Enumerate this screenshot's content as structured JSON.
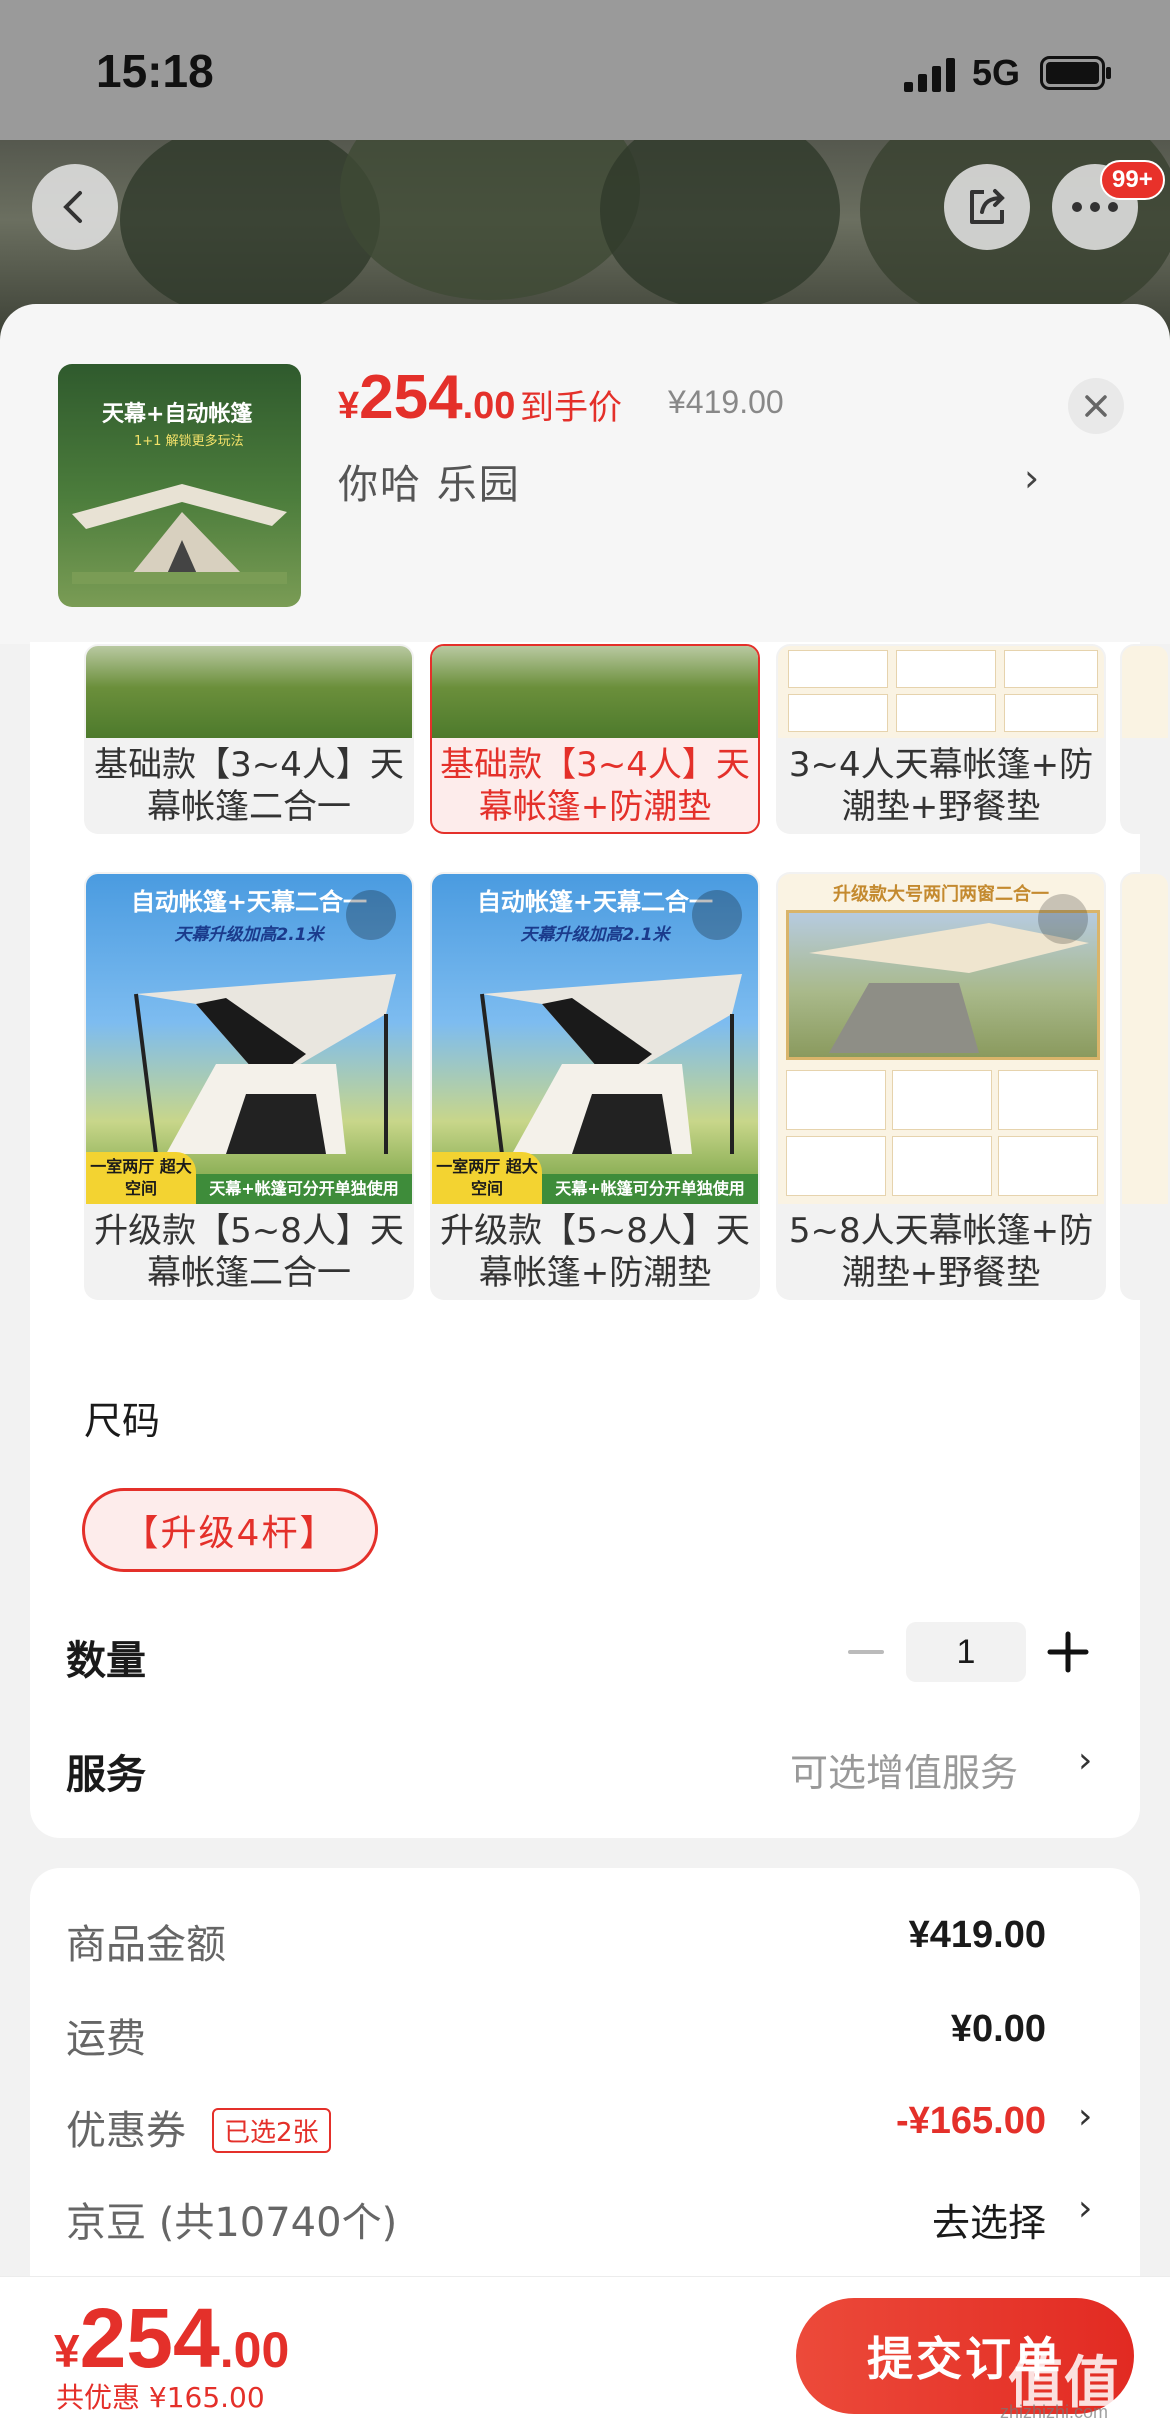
{
  "status_bar": {
    "time": "15:18",
    "network": "5G"
  },
  "header": {
    "back_icon": "chevron-left-icon",
    "share_icon": "share-icon",
    "more_icon": "more-icon",
    "more_badge": "99+"
  },
  "product": {
    "thumb_title": "天幕+自动帐篷",
    "thumb_tag": "1+1 解锁更多玩法",
    "price_currency": "¥",
    "price_int": "254",
    "price_dec": ".00",
    "price_label": "到手价",
    "original_price": "¥419.00",
    "selected_spec": "你哈  乐园"
  },
  "variants": [
    {
      "label": "基础款【3~4人】天幕帐篷二合一",
      "selected": false
    },
    {
      "label": "基础款【3~4人】天幕帐篷+防潮垫",
      "selected": true
    },
    {
      "label": "3~4人天幕帐篷+防潮垫+野餐垫",
      "selected": false
    },
    {
      "label": "升级款【5~8人】天幕帐篷二合一",
      "selected": false,
      "img_title": "自动帐篷+天幕二合一",
      "img_sub": "天幕升级加高2.1米",
      "img_yellow": "一室两厅 超大空间",
      "img_green": "天幕+帐篷可分开单独使用"
    },
    {
      "label": "升级款【5~8人】天幕帐篷+防潮垫",
      "selected": false,
      "img_title": "自动帐篷+天幕二合一",
      "img_sub": "天幕升级加高2.1米",
      "img_yellow": "一室两厅 超大空间",
      "img_green": "天幕+帐篷可分开单独使用"
    },
    {
      "label": "5~8人天幕帐篷+防潮垫+野餐垫",
      "selected": false,
      "img_title": "升级款大号两门两窗二合一"
    }
  ],
  "size": {
    "label": "尺码",
    "option": "【升级4杆】"
  },
  "quantity": {
    "label": "数量",
    "value": "1"
  },
  "service": {
    "label": "服务",
    "value": "可选增值服务"
  },
  "summary": {
    "goods_label": "商品金额",
    "goods_value": "¥419.00",
    "shipping_label": "运费",
    "shipping_value": "¥0.00",
    "coupon_label": "优惠券",
    "coupon_tag": "已选2张",
    "coupon_value": "-¥165.00",
    "jd_bean_label": "京豆 (共10740个)",
    "jd_bean_action": "去选择"
  },
  "footer": {
    "currency": "¥",
    "price_int": "254",
    "price_dec": ".00",
    "saving": "共优惠 ¥165.00",
    "submit_label": "提交订单"
  },
  "watermark": {
    "text": "值值值",
    "sub": "zhizhizhi.com"
  },
  "colors": {
    "accent": "#e4302a",
    "selected_bg": "#fdeceb"
  }
}
